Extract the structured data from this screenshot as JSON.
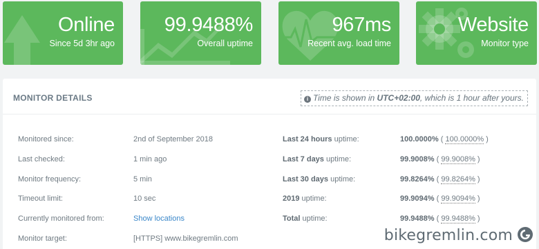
{
  "tiles": [
    {
      "value": "Online",
      "label": "Since 5d 3hr ago",
      "icon": "arrow-up-icon"
    },
    {
      "value": "99.9488%",
      "label": "Overall uptime",
      "icon": "trend-chart-icon"
    },
    {
      "value": "967ms",
      "label": "Recent avg. load time",
      "icon": "heartbeat-icon"
    },
    {
      "value": "Website",
      "label": "Monitor type",
      "icon": "gears-icon"
    }
  ],
  "details": {
    "title": "MONITOR DETAILS",
    "tz_note": {
      "prefix": "Time is shown in ",
      "zone": "UTC+02:00",
      "suffix": ", which is 1 hour after yours."
    },
    "left": [
      {
        "key": "Monitored since:",
        "value": "2nd of September 2018"
      },
      {
        "key": "Last checked:",
        "value": "1 min ago"
      },
      {
        "key": "Monitor frequency:",
        "value": "5 min"
      },
      {
        "key": "Timeout limit:",
        "value": "10 sec"
      },
      {
        "key": "Currently monitored from:",
        "value": "Show locations"
      },
      {
        "key": "Monitor target:",
        "value": "[HTTPS] www.bikegremlin.com"
      }
    ],
    "right": [
      {
        "key_bold": "Last 24 hours",
        "key_rest": " uptime:",
        "value": "100.0000%",
        "value2": "100.0000%"
      },
      {
        "key_bold": "Last 7 days",
        "key_rest": " uptime:",
        "value": "99.9008%",
        "value2": "99.9008%"
      },
      {
        "key_bold": "Last 30 days",
        "key_rest": " uptime:",
        "value": "99.8264%",
        "value2": "99.8264%"
      },
      {
        "key_bold": "2019",
        "key_rest": " uptime:",
        "value": "99.9094%",
        "value2": "99.9094%"
      },
      {
        "key_bold": "Total",
        "key_rest": " uptime:",
        "value": "99.9488%",
        "value2": "99.9488%"
      }
    ]
  },
  "watermark": "bikegremlin.com",
  "colors": {
    "tile_green": "#5cb85c",
    "link_blue": "#3a87c9"
  }
}
